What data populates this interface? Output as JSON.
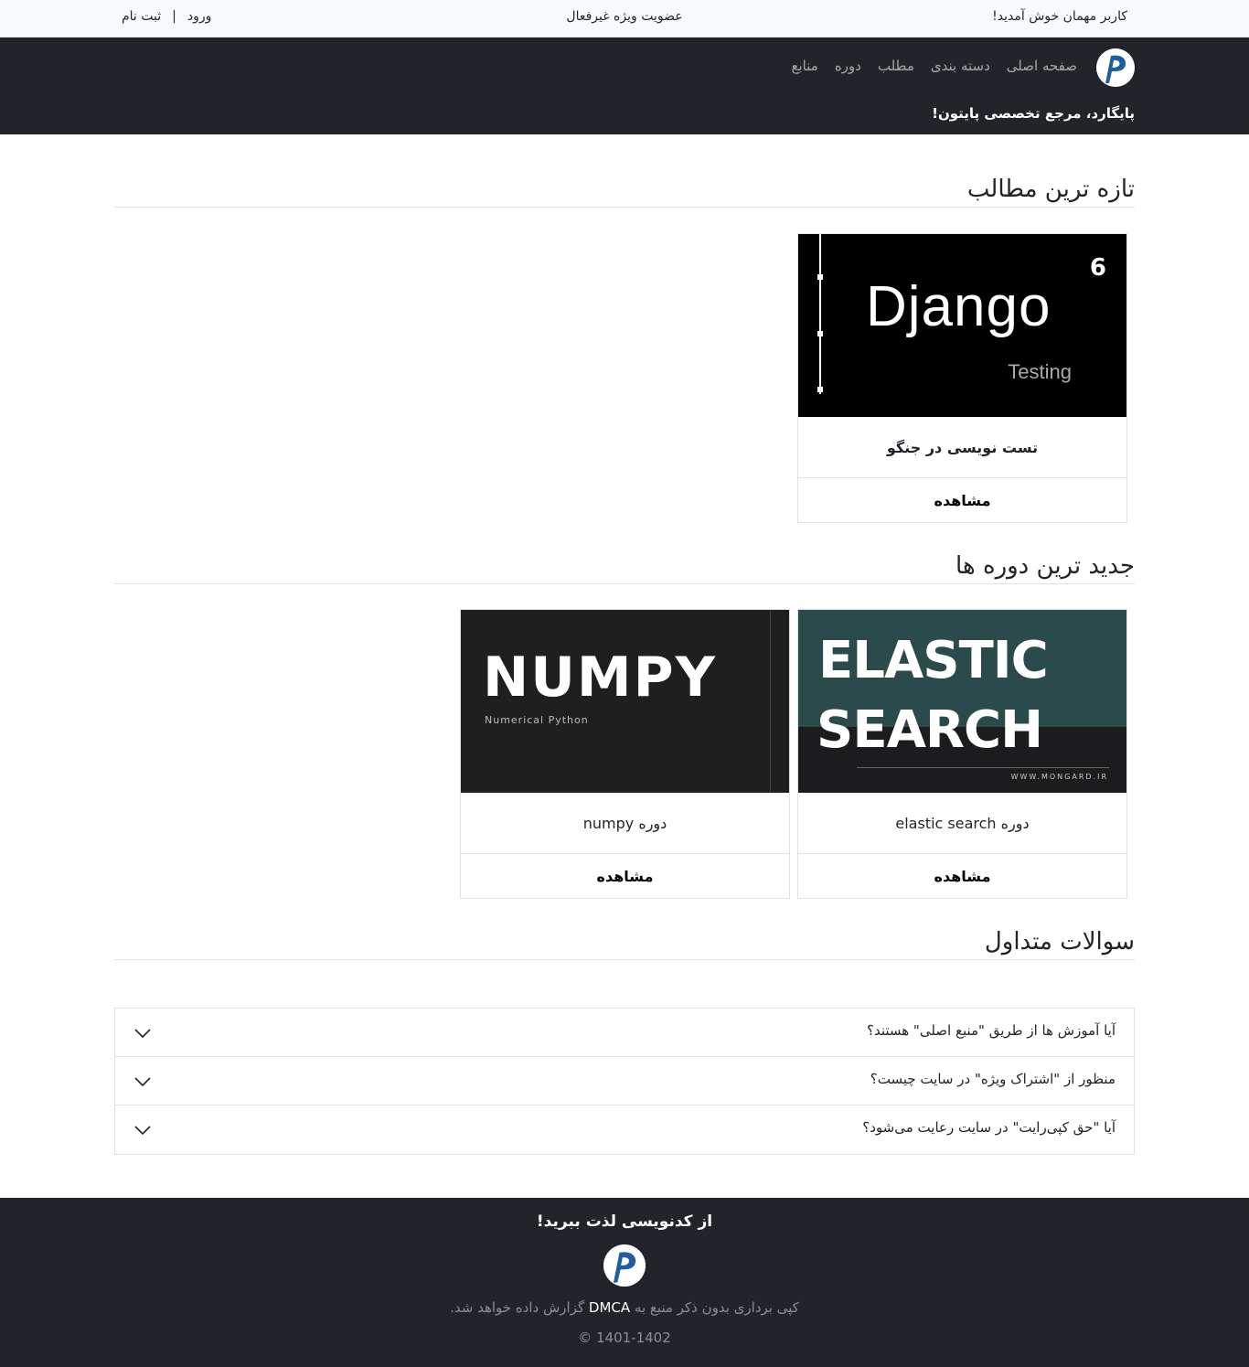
{
  "topbar": {
    "welcome": "کاربر مهمان خوش آمدید!",
    "membership": "عضویت ویژه غیرفعال",
    "login": "ورود",
    "separator": "|",
    "register": "ثبت نام"
  },
  "navbar": {
    "links": [
      "صفحه اصلی",
      "دسته بندی",
      "مطلب",
      "دوره",
      "منابع"
    ],
    "tagline": "پایگارد، مرجع تخصصی پایتون!"
  },
  "sections": {
    "latest_posts": "تازه ترین مطالب",
    "latest_courses": "جدید ترین دوره ها",
    "faq": "سوالات متداول"
  },
  "posts": [
    {
      "title": "تست نویسی در جنگو",
      "view": "مشاهده",
      "thumb_text": "Django",
      "thumb_sub": "Testing",
      "thumb_num": "6"
    }
  ],
  "courses": [
    {
      "title": "دوره elastic search",
      "view": "مشاهده",
      "thumb_line1": "ELASTIC",
      "thumb_line2": "SEARCH",
      "thumb_site": "WWW.MONGARD.IR"
    },
    {
      "title": "دوره numpy",
      "view": "مشاهده",
      "thumb_text": "NUMPY",
      "thumb_sub": "Numerical Python"
    }
  ],
  "faq": [
    {
      "question": "آیا آموزش ها از طریق \"منبع اصلی\" هستند؟"
    },
    {
      "question": "منظور از \"اشتراک ویژه\" در سایت چیست؟"
    },
    {
      "question": "آیا \"حق کپی‌رایت\" در سایت رعایت می‌شود؟"
    }
  ],
  "footer": {
    "enjoy": "از کدنویسی لذت ببرید!",
    "copy_before": "کپی برداری بدون ذکر منبع به",
    "dmca": "DMCA",
    "copy_after": "گزارش داده خواهد شد.",
    "years": "© 1401-1402"
  },
  "colors": {
    "navbar_bg": "#212529",
    "logo_blue": "#1f5f9e",
    "elastic_teal": "#2b4a4b"
  }
}
